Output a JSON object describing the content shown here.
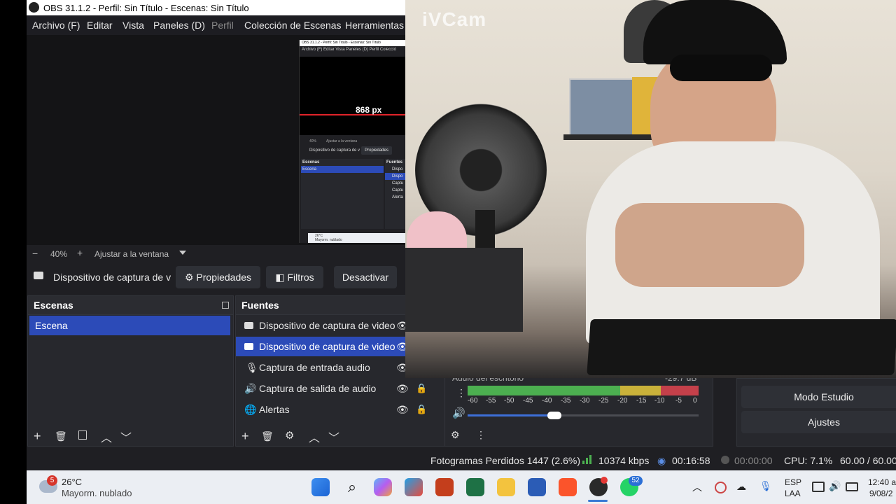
{
  "window": {
    "title": "OBS 31.1.2 - Perfil: Sin Título - Escenas: Sin Título"
  },
  "menu": [
    "Archivo (F)",
    "Editar",
    "Vista",
    "Paneles (D)",
    "Perfil",
    "Colección de Escenas",
    "Herramientas"
  ],
  "preview": {
    "inner_title": "OBS 31.1.2 - Perfil: Sin Título - Escenas: Sin Título",
    "inner_menu": "Archivo (F)   Editar   Vista   Paneles (D)   Perfil   Colecció",
    "measure": "868 px",
    "inner_zoom": "40%",
    "inner_fit": "Ajustar a la ventana",
    "inner_source": "Dispositivo de captura de v",
    "inner_props": "Propiedades",
    "inner_scenes": "Escenas",
    "inner_scene": "Escena",
    "inner_sources_head": "Fuentes",
    "inner_sources": [
      "Dispo",
      "Dispo",
      "Captu",
      "Captu",
      "Alerta"
    ],
    "inner_weather": "26°C",
    "inner_weather_desc": "Mayorm. nublado"
  },
  "zoom": {
    "minus": "−",
    "value": "40%",
    "plus": "+",
    "fit": "Ajustar a la ventana"
  },
  "source_toolbar": {
    "name": "Dispositivo de captura de v",
    "props": "Propiedades",
    "filters": "Filtros",
    "deactivate": "Desactivar"
  },
  "scenes": {
    "title": "Escenas",
    "items": [
      "Escena"
    ]
  },
  "sources": {
    "title": "Fuentes",
    "items": [
      "Dispositivo de captura de video",
      "Dispositivo de captura de video",
      "Captura de entrada audio",
      "Captura de salida de audio",
      "Alertas"
    ]
  },
  "mixer": {
    "label": "Audio del escritorio",
    "db": "-29.7 dB",
    "scale": [
      "-60",
      "-55",
      "-50",
      "-45",
      "-40",
      "-35",
      "-30",
      "-25",
      "-20",
      "-15",
      "-10",
      "-5",
      "0"
    ]
  },
  "controls": {
    "studio": "Modo Estudio",
    "settings": "Ajustes"
  },
  "status": {
    "dropped": "Fotogramas Perdidos 1447 (2.6%)",
    "bitrate": "10374 kbps",
    "stream_time": "00:16:58",
    "rec_time": "00:00:00",
    "cpu": "CPU: 7.1%",
    "fps": "60.00 / 60.00"
  },
  "webcam": {
    "watermark": "iVCam"
  },
  "taskbar": {
    "weather_badge": "5",
    "temp": "26°C",
    "weather": "Mayorm. nublado",
    "whatsapp_badge": "52",
    "lang1": "ESP",
    "lang2": "LAA",
    "time": "12:40 a",
    "date": "9/08/2"
  },
  "colors": {
    "selected": "#2c4bb8",
    "meter_green": "#4caf50",
    "meter_yellow": "#c9b13a",
    "meter_red": "#c4404a"
  }
}
